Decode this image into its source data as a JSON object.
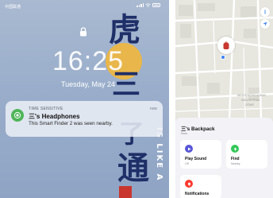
{
  "lock_screen": {
    "carrier": "中国联通",
    "time": "16:25",
    "date": "Tuesday, May 24",
    "calligraphy": [
      "虎",
      "三",
      "了",
      "通"
    ],
    "vertical_text": "IS LIKE A",
    "notification": {
      "label": "TIME SENSITIVE",
      "when": "now",
      "title": "三's Headphones",
      "body": "This Smart Finder 2 was seen nearby."
    }
  },
  "find_my": {
    "map_labels": [
      "MEIKENGHUAJING",
      "INDUSTRIAL",
      "ZONE"
    ],
    "item": {
      "title": "三's Backpack",
      "subtitle": "Now"
    },
    "actions": [
      {
        "label": "Play Sound",
        "sub": "Off"
      },
      {
        "label": "Find",
        "sub": "Nearby"
      },
      {
        "label": "Notifications",
        "sub": ""
      }
    ]
  },
  "colors": {
    "notification_icon": "#4fb55a",
    "play_sound_icon": "#5856d6",
    "find_icon": "#34c759",
    "notifications_icon": "#ff3b30",
    "calligraphy": "#1f2f68",
    "sun": "#e8b64a"
  },
  "icons": {
    "status": [
      "signal-icon",
      "wifi-icon",
      "battery-icon"
    ],
    "lock": "lock-icon",
    "notification": "findmy-icon",
    "map_buttons": [
      "info-icon",
      "location-arrow-icon"
    ],
    "pin": "backpack-icon",
    "actions": [
      "play-icon",
      "arrow-up-icon",
      "bell-icon"
    ]
  }
}
